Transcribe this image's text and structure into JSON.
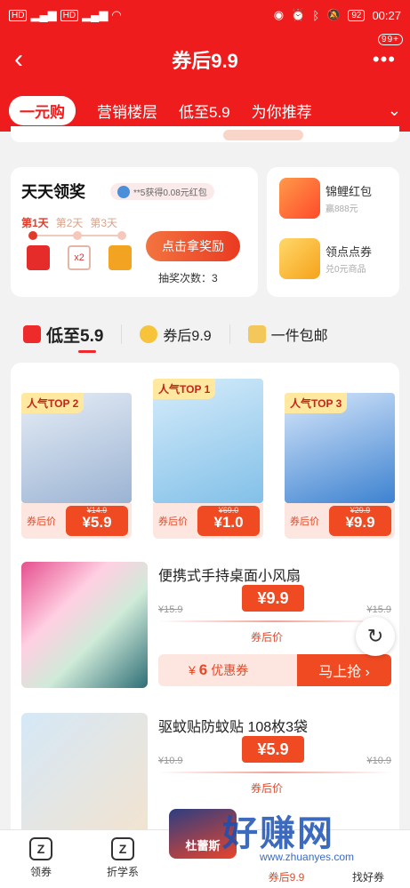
{
  "status": {
    "network_left": "HD",
    "network_right": "HD",
    "signal": "4G",
    "battery": "92",
    "time": "00:27"
  },
  "nav": {
    "back_icon": "chevron-left-icon",
    "title": "券后9.9",
    "more_icon": "more-icon",
    "more_badge": "99+"
  },
  "tabs": [
    {
      "label": "一元购",
      "active": true
    },
    {
      "label": "营销楼层"
    },
    {
      "label": "低至5.9"
    },
    {
      "label": "为你推荐"
    }
  ],
  "tabs_more_icon": "chevron-down-icon",
  "reward": {
    "title": "天天领奖",
    "tip": "**5获得0.08元红包",
    "days": [
      "第1天",
      "第2天",
      "第3天"
    ],
    "gift2_text": "x2",
    "claim_button": "点击拿奖励",
    "draws": "抽奖次数：3"
  },
  "side": [
    {
      "name": "锦鲤红包",
      "sub": "赢888元",
      "icon": "red-envelope-icon"
    },
    {
      "name": "领点点券",
      "sub": "兑0元商品",
      "icon": "coupon-icon"
    }
  ],
  "categories": [
    {
      "label": "低至5.9",
      "icon": "truck-icon",
      "active": true
    },
    {
      "label": "券后9.9",
      "icon": "hand-icon"
    },
    {
      "label": "一件包邮",
      "icon": "gift-icon"
    }
  ],
  "top3": [
    {
      "badge": "人气TOP 2",
      "label": "券后价",
      "orig": "¥14.9",
      "price": "¥5.9"
    },
    {
      "badge": "人气TOP 1",
      "label": "券后价",
      "orig": "¥69.0",
      "price": "¥1.0"
    },
    {
      "badge": "人气TOP 3",
      "label": "券后价",
      "orig": "¥29.9",
      "price": "¥9.9"
    }
  ],
  "items": [
    {
      "name": "便携式手持桌面小风扇",
      "orig_left": "¥15.9",
      "orig_right": "¥15.9",
      "price": "¥9.9",
      "price_label": "券后价",
      "coupon_prefix": "¥",
      "coupon_value": "6",
      "coupon_text": "优惠券",
      "buy_label": "马上抢 ›"
    },
    {
      "name": "驱蚊贴防蚊贴 108枚3袋",
      "orig_left": "¥10.9",
      "orig_right": "¥10.9",
      "price": "¥5.9",
      "price_label": "券后价"
    }
  ],
  "bottom": [
    {
      "label": "领券",
      "icon": "coupon-tab-icon"
    },
    {
      "label": "折学系",
      "icon": "discount-tab-icon"
    },
    {
      "label": "券后9.9",
      "icon": "price-tab-icon"
    },
    {
      "label": "找好券",
      "icon": "find-tab-icon"
    }
  ],
  "promo_label": "杜蕾斯",
  "watermark": {
    "cn": "好赚网",
    "url": "www.zhuanyes.com"
  }
}
